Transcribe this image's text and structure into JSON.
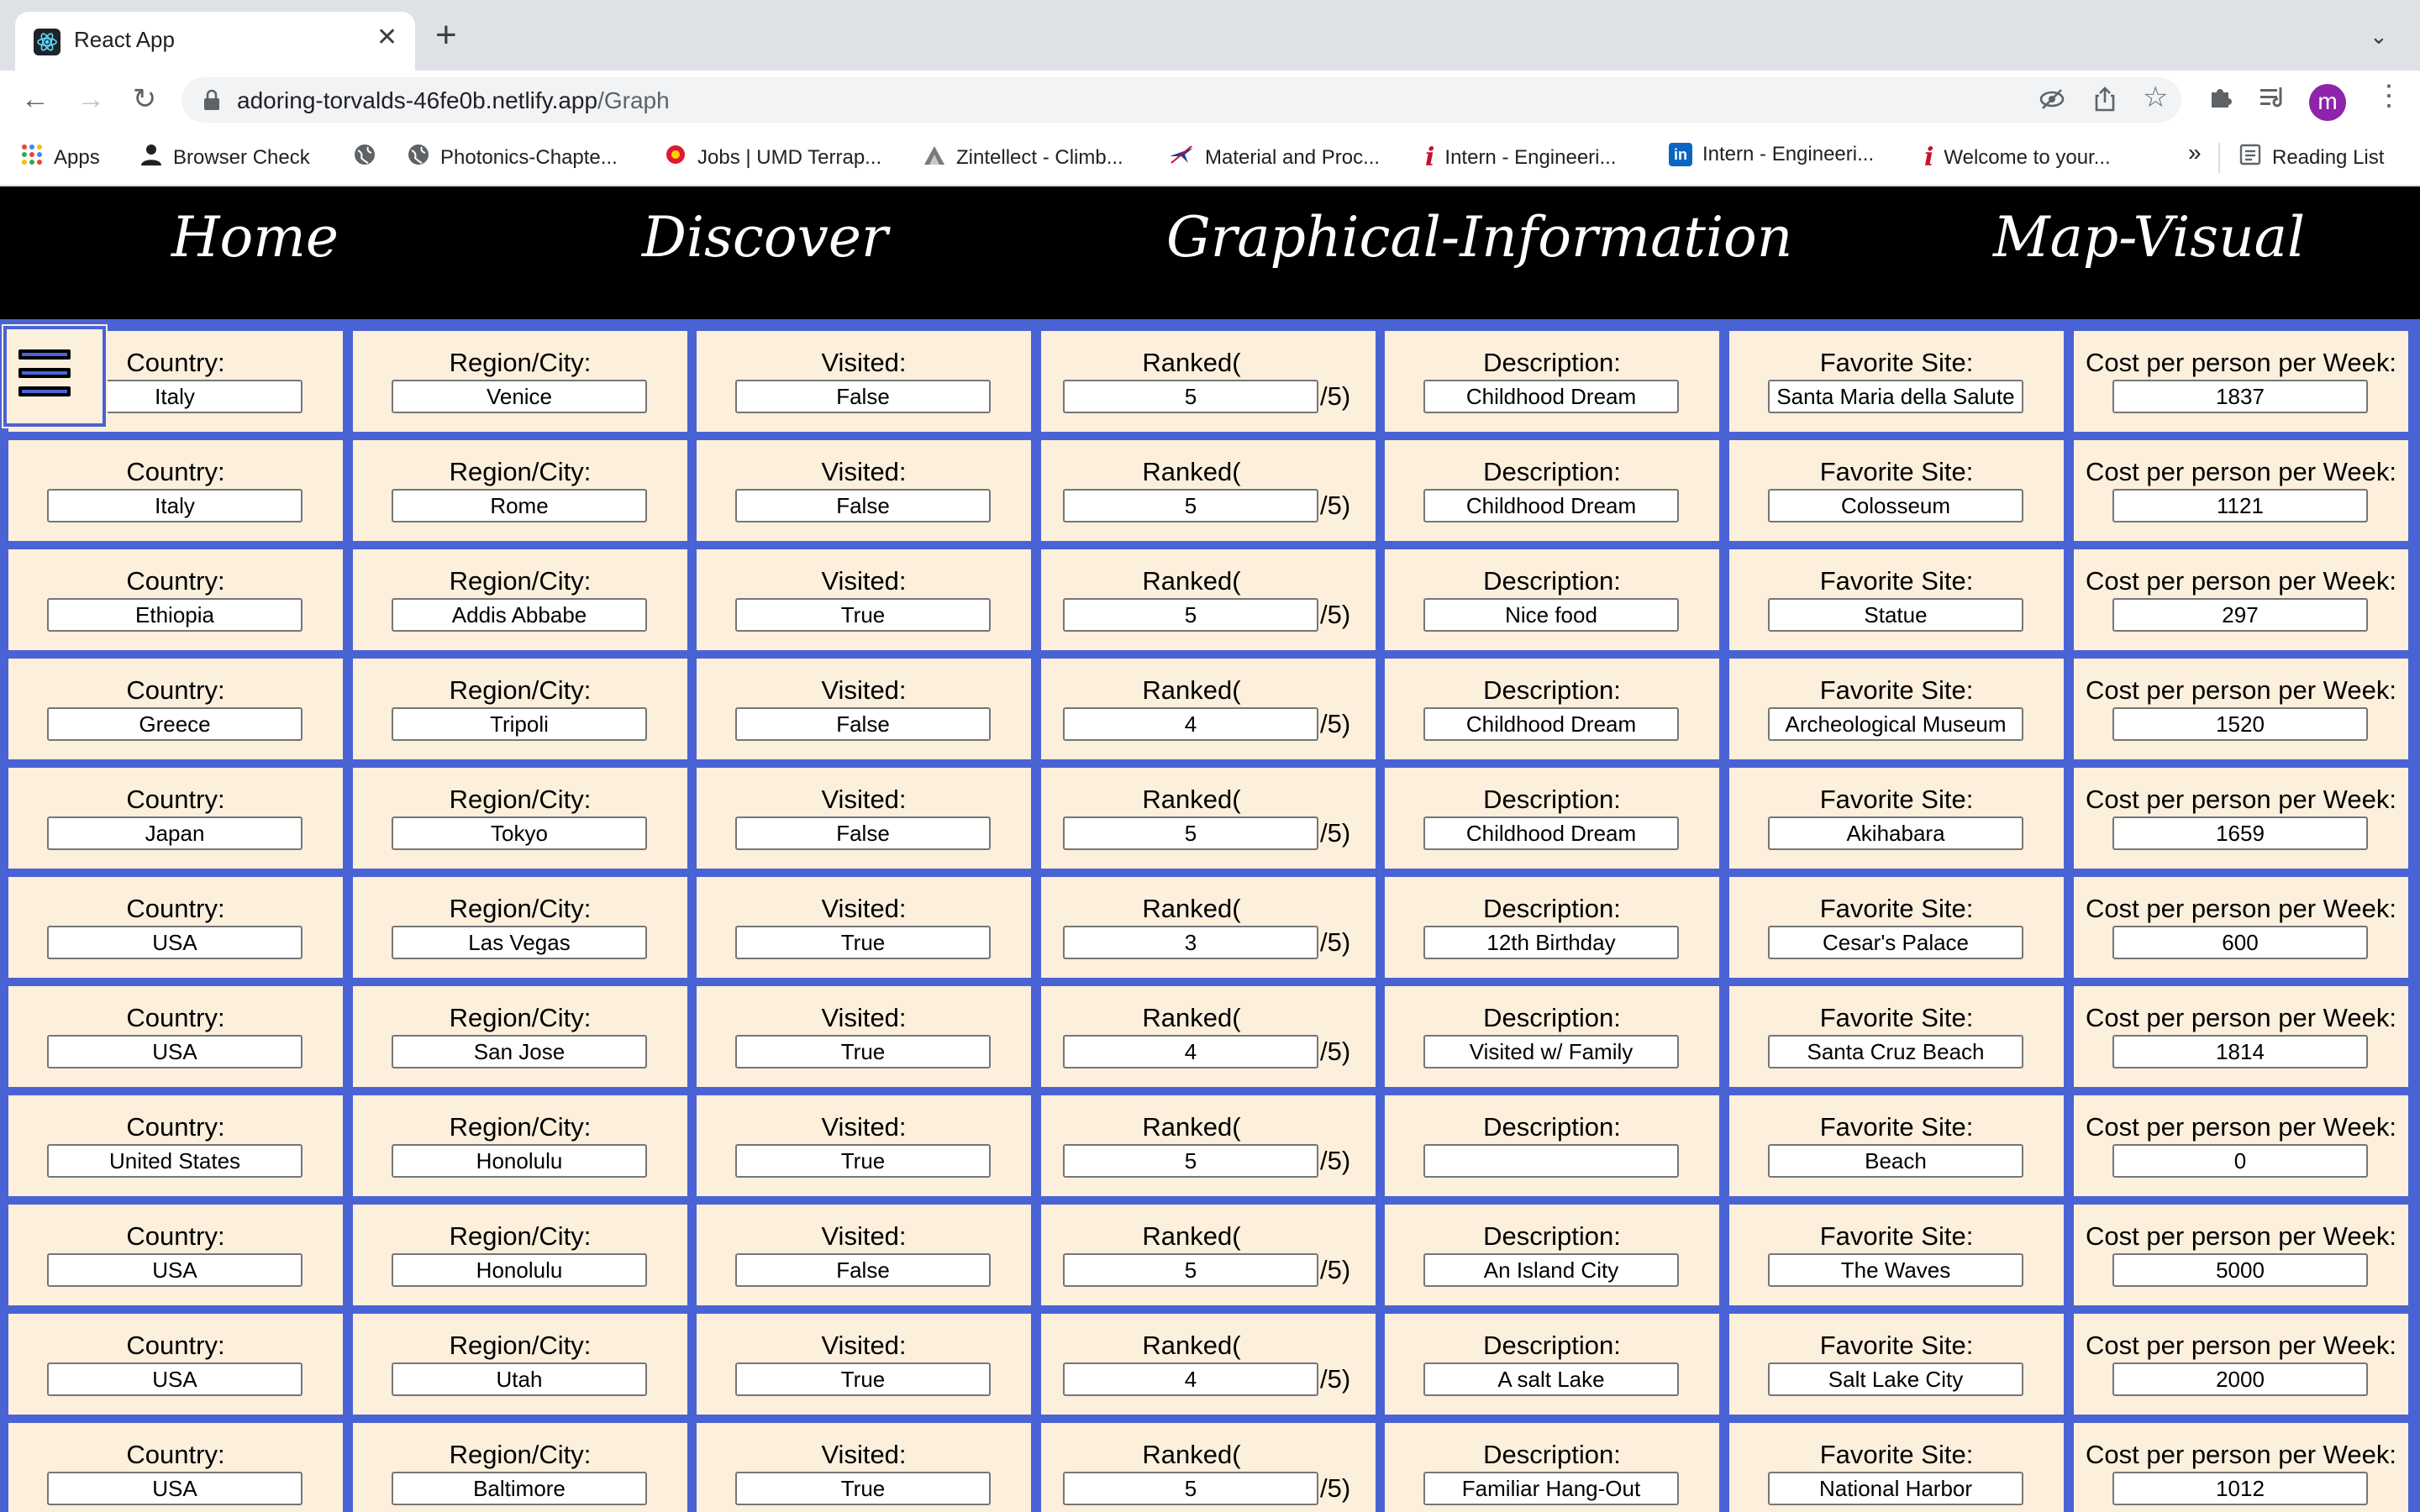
{
  "browser": {
    "tab_title": "React App",
    "url_host": "adoring-torvalds-46fe0b.netlify.app",
    "url_path": "/Graph",
    "avatar_letter": "m",
    "bookmarks": [
      {
        "label": "Apps",
        "icon": "apps-grid-icon"
      },
      {
        "label": "Browser Check",
        "icon": "person-icon"
      },
      {
        "label": "",
        "icon": "globe-icon"
      },
      {
        "label": "Photonics-Chapte...",
        "icon": "globe-icon"
      },
      {
        "label": "Jobs | UMD Terrap...",
        "icon": "umd-icon"
      },
      {
        "label": "Zintellect - Climb...",
        "icon": "zintellect-icon"
      },
      {
        "label": "Material and Proc...",
        "icon": "plane-icon"
      },
      {
        "label": "Intern - Engineeri...",
        "icon": "info-icon"
      },
      {
        "label": "Intern - Engineeri...",
        "icon": "linkedin-icon"
      },
      {
        "label": "Welcome to your...",
        "icon": "info-icon"
      }
    ],
    "overflow_label": "»",
    "reading_list_label": "Reading List"
  },
  "nav": {
    "home": "Home",
    "discover": "Discover",
    "graphical": "Graphical-Information",
    "map": "Map-Visual"
  },
  "labels": {
    "country": "Country:",
    "region": "Region/City:",
    "visited": "Visited:",
    "ranked_prefix": "Ranked(",
    "ranked_suffix": "/5)",
    "description": "Description:",
    "favorite": "Favorite Site:",
    "cost": "Cost per person per Week:"
  },
  "rows": [
    {
      "country": "Italy",
      "region": "Venice",
      "visited": "False",
      "rank": "5",
      "description": "Childhood Dream",
      "favorite": "Santa Maria della Salute",
      "cost": "1837"
    },
    {
      "country": "Italy",
      "region": "Rome",
      "visited": "False",
      "rank": "5",
      "description": "Childhood Dream",
      "favorite": "Colosseum",
      "cost": "1121"
    },
    {
      "country": "Ethiopia",
      "region": "Addis Abbabe",
      "visited": "True",
      "rank": "5",
      "description": "Nice food",
      "favorite": "Statue",
      "cost": "297"
    },
    {
      "country": "Greece",
      "region": "Tripoli",
      "visited": "False",
      "rank": "4",
      "description": "Childhood Dream",
      "favorite": "Archeological Museum",
      "cost": "1520"
    },
    {
      "country": "Japan",
      "region": "Tokyo",
      "visited": "False",
      "rank": "5",
      "description": "Childhood Dream",
      "favorite": "Akihabara",
      "cost": "1659"
    },
    {
      "country": "USA",
      "region": "Las Vegas",
      "visited": "True",
      "rank": "3",
      "description": "12th Birthday",
      "favorite": "Cesar's Palace",
      "cost": "600"
    },
    {
      "country": "USA",
      "region": "San Jose",
      "visited": "True",
      "rank": "4",
      "description": "Visited w/ Family",
      "favorite": "Santa Cruz Beach",
      "cost": "1814"
    },
    {
      "country": "United States",
      "region": "Honolulu",
      "visited": "True",
      "rank": "5",
      "description": "",
      "favorite": "Beach",
      "cost": "0"
    },
    {
      "country": "USA",
      "region": "Honolulu",
      "visited": "False",
      "rank": "5",
      "description": "An Island City",
      "favorite": "The Waves",
      "cost": "5000"
    },
    {
      "country": "USA",
      "region": "Utah",
      "visited": "True",
      "rank": "4",
      "description": "A salt Lake",
      "favorite": "Salt Lake City",
      "cost": "2000"
    },
    {
      "country": "USA",
      "region": "Baltimore",
      "visited": "True",
      "rank": "5",
      "description": "Familiar Hang-Out",
      "favorite": "National Harbor",
      "cost": "1012"
    }
  ]
}
